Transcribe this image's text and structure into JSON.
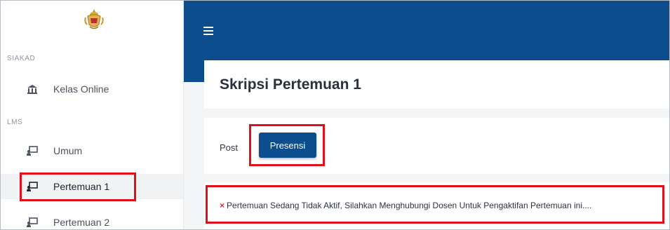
{
  "sidebar": {
    "sections": [
      {
        "label": "SIAKAD"
      },
      {
        "label": "LMS"
      }
    ],
    "items": [
      {
        "label": "Kelas Online",
        "icon": "university-icon"
      },
      {
        "label": "Umum",
        "icon": "chalkboard-teacher-icon"
      },
      {
        "label": "Pertemuan 1",
        "icon": "chalkboard-teacher-icon",
        "active": true
      },
      {
        "label": "Pertemuan 2",
        "icon": "chalkboard-teacher-icon"
      }
    ]
  },
  "header": {
    "menu_icon": "hamburger-menu-icon"
  },
  "main": {
    "title": "Skripsi Pertemuan 1",
    "tabs": [
      {
        "label": "Post"
      },
      {
        "label": "Presensi",
        "active": true
      }
    ],
    "alert": {
      "icon": "×",
      "message": "Pertemuan Sedang Tidak Aktif, Silahkan Menghubungi Dosen Untuk Pengaktifan Pertemuan ini...."
    }
  },
  "colors": {
    "brand": "#0c4d8d",
    "highlight": "#e0101a",
    "error": "#e0282c"
  }
}
